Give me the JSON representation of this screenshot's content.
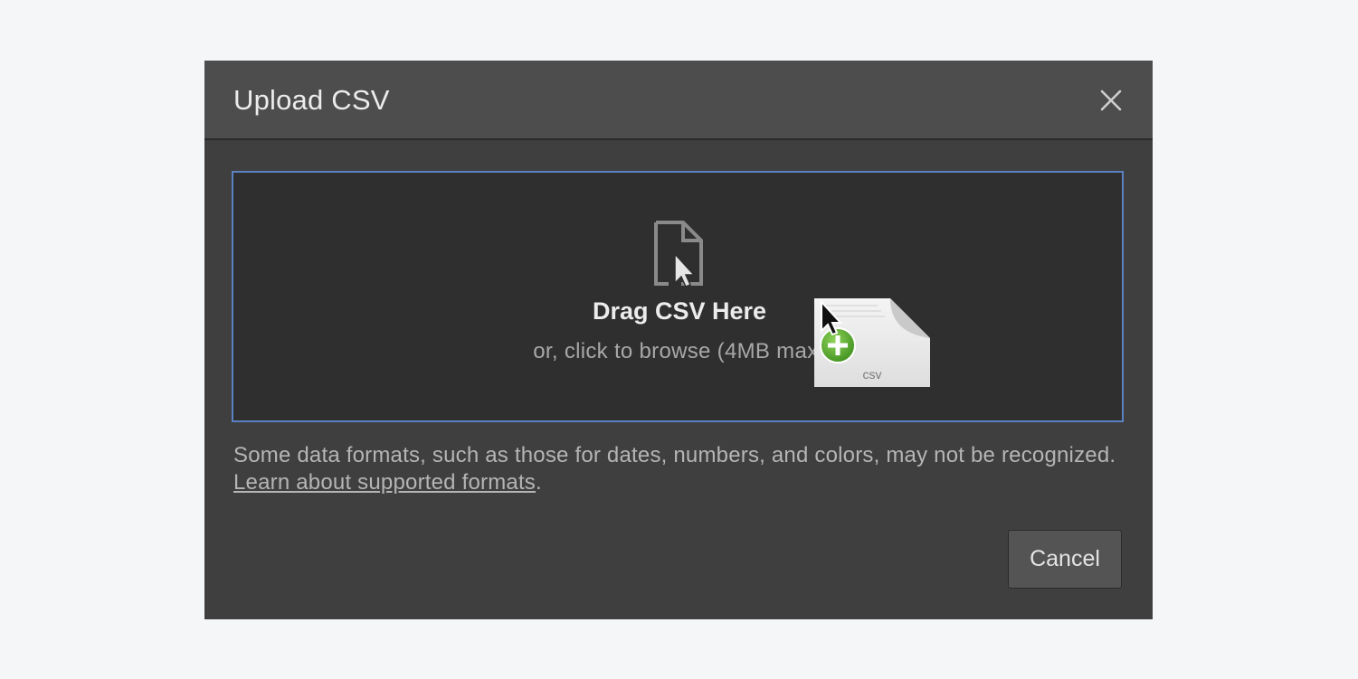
{
  "modal": {
    "title": "Upload CSV",
    "close_icon": "close-icon"
  },
  "dropzone": {
    "icon": "file-cursor-icon",
    "title": "Drag CSV Here",
    "subtitle": "or, click to browse (4MB max)",
    "drag_ghost": {
      "file_label": "csv",
      "badge_icon": "plus-badge-icon"
    },
    "border_color": "#5a82c2"
  },
  "note": {
    "text": "Some data formats, such as those for dates, numbers, and colors, may not be recognized.",
    "link_label": "Learn about supported formats",
    "suffix": "."
  },
  "footer": {
    "cancel_label": "Cancel"
  }
}
